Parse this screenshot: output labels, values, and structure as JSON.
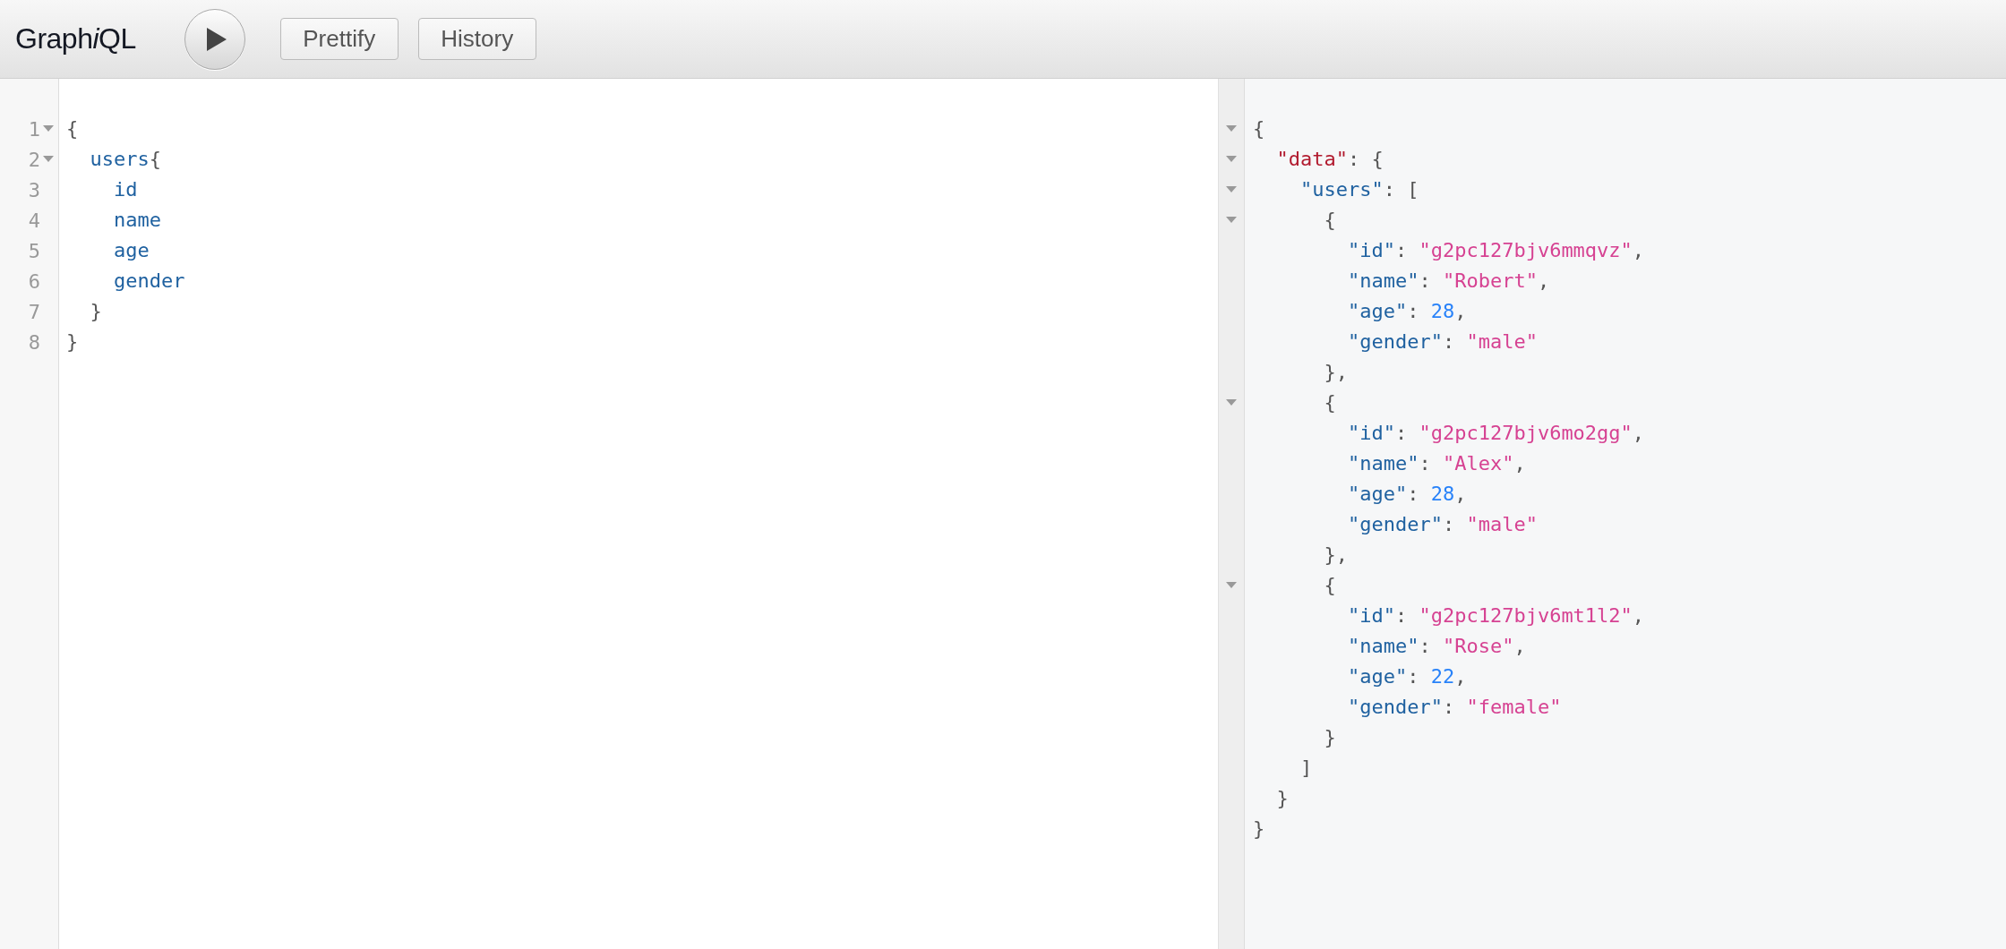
{
  "toolbar": {
    "title": [
      {
        "text": "Graph",
        "italic": false
      },
      {
        "text": "i",
        "italic": true
      },
      {
        "text": "QL",
        "italic": false
      }
    ],
    "buttons": [
      {
        "kind": "run"
      },
      {
        "kind": "text",
        "label": "Prettify"
      },
      {
        "kind": "text",
        "label": "History"
      }
    ]
  },
  "query_editor": {
    "lines": [
      {
        "number": "1",
        "foldable": true,
        "tokens": [
          {
            "kind": "punct",
            "text": "{"
          }
        ]
      },
      {
        "number": "2",
        "foldable": true,
        "tokens": [
          {
            "kind": "field",
            "text": "users"
          },
          {
            "kind": "punct",
            "text": "{"
          }
        ]
      },
      {
        "number": "3",
        "foldable": false,
        "tokens": [
          {
            "kind": "field",
            "text": "id"
          }
        ]
      },
      {
        "number": "4",
        "foldable": false,
        "tokens": [
          {
            "kind": "field",
            "text": "name"
          }
        ]
      },
      {
        "number": "5",
        "foldable": false,
        "tokens": [
          {
            "kind": "field",
            "text": "age"
          }
        ]
      },
      {
        "number": "6",
        "foldable": false,
        "tokens": [
          {
            "kind": "field",
            "text": "gender"
          }
        ]
      },
      {
        "number": "7",
        "foldable": false,
        "tokens": [
          {
            "kind": "punct",
            "text": "}"
          }
        ]
      },
      {
        "number": "8",
        "foldable": false,
        "tokens": [
          {
            "kind": "punct",
            "text": "}"
          }
        ]
      }
    ]
  },
  "result_viewer": {
    "lines": [
      {
        "foldable": true,
        "tokens": [
          {
            "kind": "punct",
            "text": "{"
          }
        ]
      },
      {
        "foldable": true,
        "tokens": [
          {
            "kind": "rootkey",
            "text": "\"data\""
          },
          {
            "kind": "punct",
            "text": ": {"
          }
        ]
      },
      {
        "foldable": true,
        "tokens": [
          {
            "kind": "key",
            "text": "\"users\""
          },
          {
            "kind": "punct",
            "text": ": ["
          }
        ]
      },
      {
        "foldable": true,
        "tokens": [
          {
            "kind": "punct",
            "text": "{"
          }
        ]
      },
      {
        "foldable": false,
        "tokens": [
          {
            "kind": "key",
            "text": "\"id\""
          },
          {
            "kind": "punct",
            "text": ": "
          },
          {
            "kind": "string",
            "text": "\"g2pc127bjv6mmqvz\""
          },
          {
            "kind": "punct",
            "text": ","
          }
        ]
      },
      {
        "foldable": false,
        "tokens": [
          {
            "kind": "key",
            "text": "\"name\""
          },
          {
            "kind": "punct",
            "text": ": "
          },
          {
            "kind": "string",
            "text": "\"Robert\""
          },
          {
            "kind": "punct",
            "text": ","
          }
        ]
      },
      {
        "foldable": false,
        "tokens": [
          {
            "kind": "key",
            "text": "\"age\""
          },
          {
            "kind": "punct",
            "text": ": "
          },
          {
            "kind": "number",
            "text": "28"
          },
          {
            "kind": "punct",
            "text": ","
          }
        ]
      },
      {
        "foldable": false,
        "tokens": [
          {
            "kind": "key",
            "text": "\"gender\""
          },
          {
            "kind": "punct",
            "text": ": "
          },
          {
            "kind": "string",
            "text": "\"male\""
          }
        ]
      },
      {
        "foldable": false,
        "tokens": [
          {
            "kind": "punct",
            "text": "},"
          }
        ]
      },
      {
        "foldable": true,
        "tokens": [
          {
            "kind": "punct",
            "text": "{"
          }
        ]
      },
      {
        "foldable": false,
        "tokens": [
          {
            "kind": "key",
            "text": "\"id\""
          },
          {
            "kind": "punct",
            "text": ": "
          },
          {
            "kind": "string",
            "text": "\"g2pc127bjv6mo2gg\""
          },
          {
            "kind": "punct",
            "text": ","
          }
        ]
      },
      {
        "foldable": false,
        "tokens": [
          {
            "kind": "key",
            "text": "\"name\""
          },
          {
            "kind": "punct",
            "text": ": "
          },
          {
            "kind": "string",
            "text": "\"Alex\""
          },
          {
            "kind": "punct",
            "text": ","
          }
        ]
      },
      {
        "foldable": false,
        "tokens": [
          {
            "kind": "key",
            "text": "\"age\""
          },
          {
            "kind": "punct",
            "text": ": "
          },
          {
            "kind": "number",
            "text": "28"
          },
          {
            "kind": "punct",
            "text": ","
          }
        ]
      },
      {
        "foldable": false,
        "tokens": [
          {
            "kind": "key",
            "text": "\"gender\""
          },
          {
            "kind": "punct",
            "text": ": "
          },
          {
            "kind": "string",
            "text": "\"male\""
          }
        ]
      },
      {
        "foldable": false,
        "tokens": [
          {
            "kind": "punct",
            "text": "},"
          }
        ]
      },
      {
        "foldable": true,
        "tokens": [
          {
            "kind": "punct",
            "text": "{"
          }
        ]
      },
      {
        "foldable": false,
        "tokens": [
          {
            "kind": "key",
            "text": "\"id\""
          },
          {
            "kind": "punct",
            "text": ": "
          },
          {
            "kind": "string",
            "text": "\"g2pc127bjv6mt1l2\""
          },
          {
            "kind": "punct",
            "text": ","
          }
        ]
      },
      {
        "foldable": false,
        "tokens": [
          {
            "kind": "key",
            "text": "\"name\""
          },
          {
            "kind": "punct",
            "text": ": "
          },
          {
            "kind": "string",
            "text": "\"Rose\""
          },
          {
            "kind": "punct",
            "text": ","
          }
        ]
      },
      {
        "foldable": false,
        "tokens": [
          {
            "kind": "key",
            "text": "\"age\""
          },
          {
            "kind": "punct",
            "text": ": "
          },
          {
            "kind": "number",
            "text": "22"
          },
          {
            "kind": "punct",
            "text": ","
          }
        ]
      },
      {
        "foldable": false,
        "tokens": [
          {
            "kind": "key",
            "text": "\"gender\""
          },
          {
            "kind": "punct",
            "text": ": "
          },
          {
            "kind": "string",
            "text": "\"female\""
          }
        ]
      },
      {
        "foldable": false,
        "tokens": [
          {
            "kind": "punct",
            "text": "}"
          }
        ]
      },
      {
        "foldable": false,
        "tokens": [
          {
            "kind": "punct",
            "text": "]"
          }
        ]
      },
      {
        "foldable": false,
        "tokens": [
          {
            "kind": "punct",
            "text": "}"
          }
        ]
      },
      {
        "foldable": false,
        "tokens": [
          {
            "kind": "punct",
            "text": "}"
          }
        ]
      }
    ]
  }
}
